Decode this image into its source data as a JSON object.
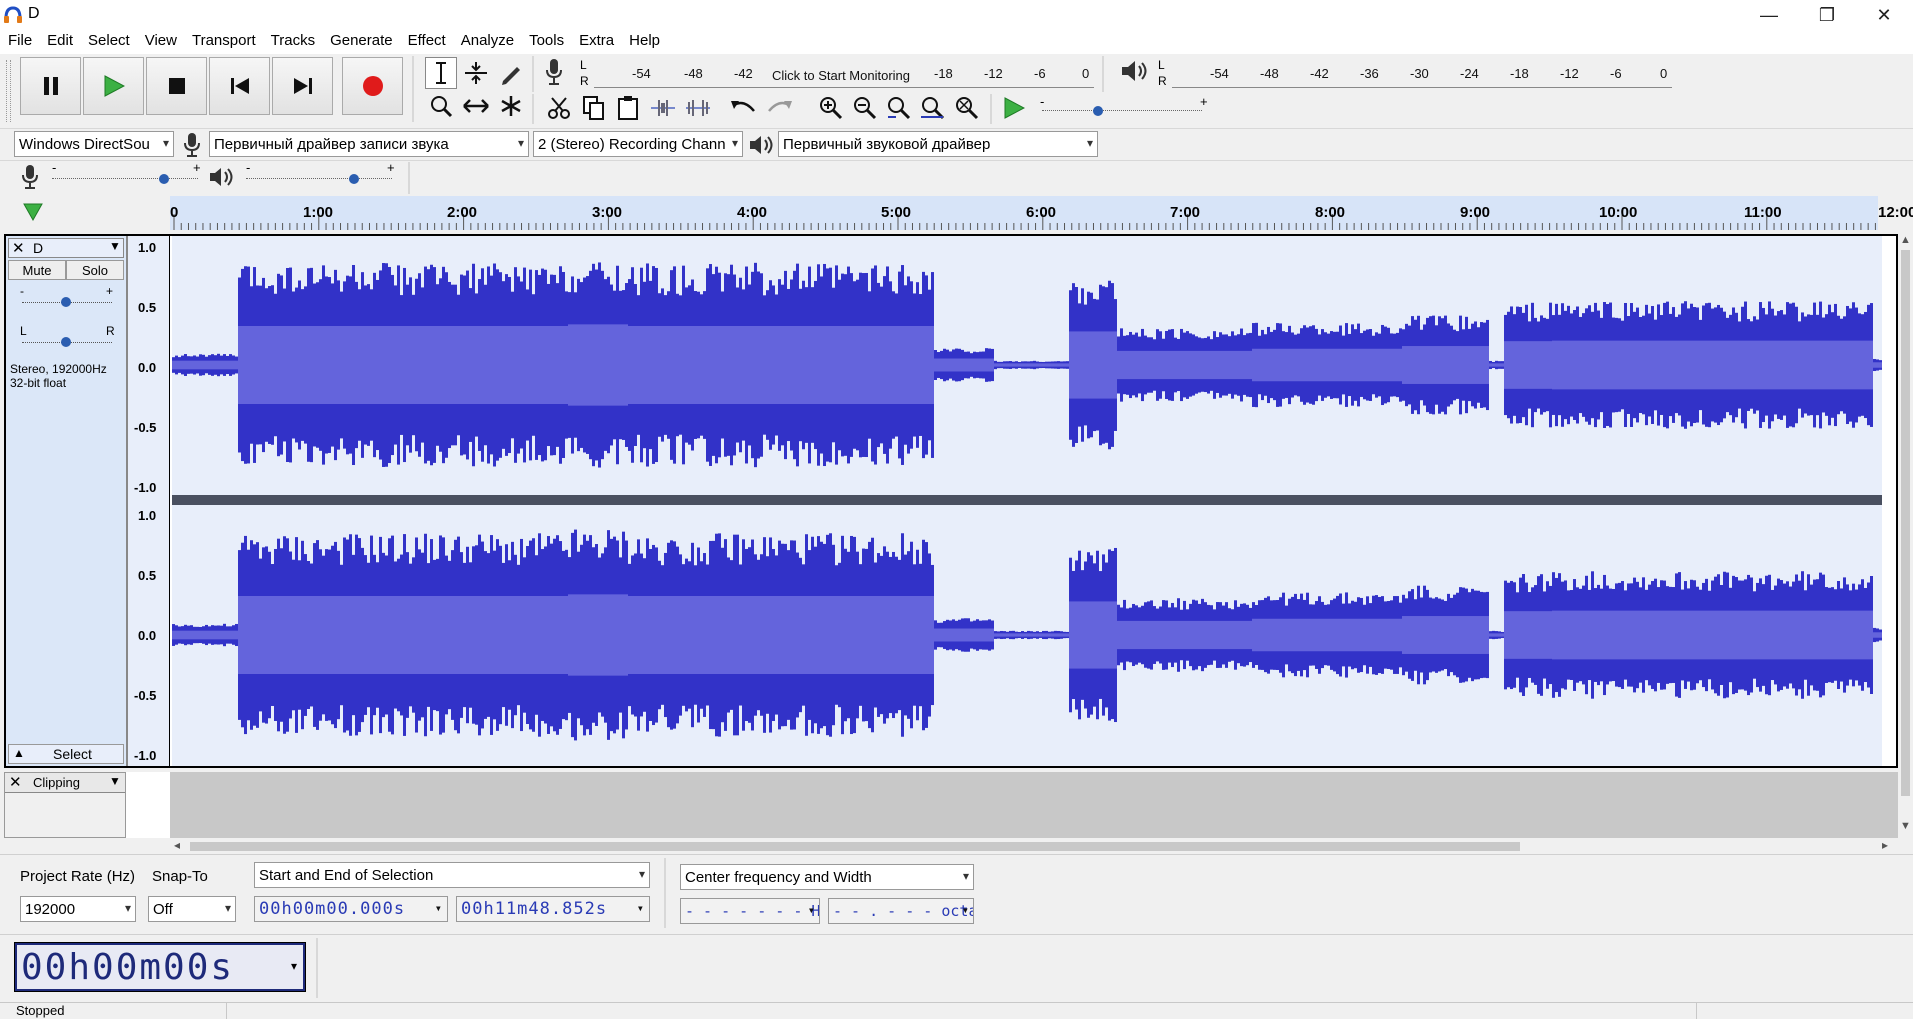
{
  "window": {
    "title": "D",
    "minimize": "—",
    "restore": "❐",
    "close": "✕"
  },
  "menu": [
    "File",
    "Edit",
    "Select",
    "View",
    "Transport",
    "Tracks",
    "Generate",
    "Effect",
    "Analyze",
    "Tools",
    "Extra",
    "Help"
  ],
  "meters": {
    "record": {
      "lr": "L\nR",
      "scale": [
        "-54",
        "-48",
        "-42",
        "Click to Start Monitoring",
        "-18",
        "-12",
        "-6",
        "0"
      ]
    },
    "play": {
      "scale": [
        "-54",
        "-48",
        "-42",
        "-36",
        "-30",
        "-24",
        "-18",
        "-12",
        "-6",
        "0"
      ]
    }
  },
  "devices": {
    "host": "Windows DirectSou",
    "record_device": "Первичный драйвер записи звука",
    "channels": "2 (Stereo) Recording Chann",
    "play_device": "Первичный звуковой драйвер"
  },
  "timeline": {
    "ticks": [
      "0",
      "1:00",
      "2:00",
      "3:00",
      "4:00",
      "5:00",
      "6:00",
      "7:00",
      "8:00",
      "9:00",
      "10:00",
      "11:00",
      "12:00"
    ]
  },
  "track": {
    "name": "D",
    "mute": "Mute",
    "solo": "Solo",
    "gain_minus": "-",
    "gain_plus": "+",
    "pan_l": "L",
    "pan_r": "R",
    "info": "Stereo, 192000Hz\n32-bit float",
    "select": "Select",
    "yaxis": [
      "1.0",
      "0.5",
      "0.0",
      "-0.5",
      "-1.0"
    ]
  },
  "label_track": {
    "name": "Clipping"
  },
  "selection": {
    "rate_label": "Project Rate (Hz)",
    "rate_value": "192000",
    "snap_label": "Snap-To",
    "snap_value": "Off",
    "mode": "Start and End of Selection",
    "start": "00h00m00.000s",
    "end": "00h11m48.852s",
    "spectral_mode": "Center frequency and Width",
    "freq": "- - - - - - -  Hz",
    "width": "- - . - - -  octaves"
  },
  "time": {
    "value": "00h00m00s"
  },
  "status": {
    "text": "Stopped"
  },
  "colors": {
    "wave_dark": "#3232c8",
    "wave_light": "#6464dc",
    "track_bg": "#e8eefa",
    "ruler_bg": "#d7e4f8"
  }
}
